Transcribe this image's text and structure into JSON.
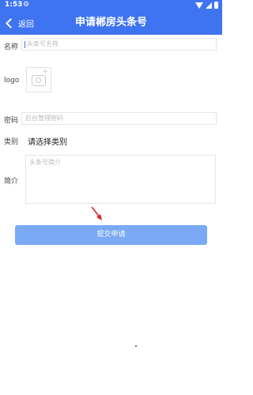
{
  "status_bar": {
    "time": "1:53",
    "gear_icon": "gear-icon"
  },
  "header": {
    "back_label": "返回",
    "title": "申请郴房头条号"
  },
  "form": {
    "name": {
      "label": "名称",
      "placeholder": "头条号名称"
    },
    "logo": {
      "label": "logo"
    },
    "password": {
      "label": "密码",
      "placeholder": "后台管理密码"
    },
    "category": {
      "label": "类别",
      "value": "请选择类别"
    },
    "intro": {
      "label": "简介",
      "placeholder": "头条号简介"
    },
    "submit_label": "提交申请"
  },
  "colors": {
    "accent": "#3f74f0",
    "submit_bg": "#7aaaf5",
    "arrow": "#e02020"
  }
}
